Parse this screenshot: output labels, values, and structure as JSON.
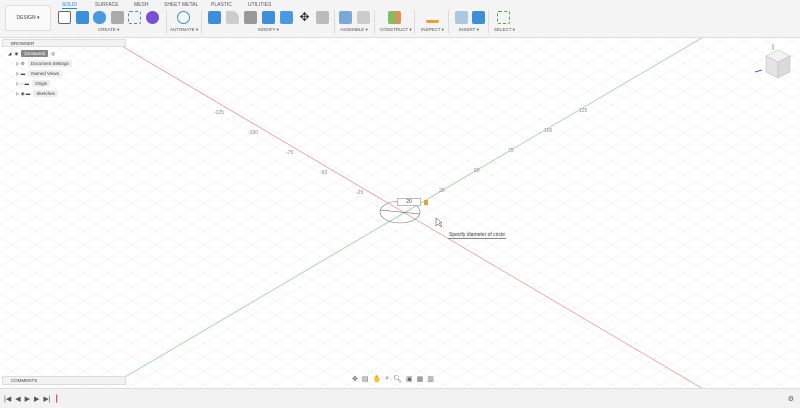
{
  "toolbar": {
    "workspace": "DESIGN ▾",
    "tabs": [
      "SOLID",
      "SURFACE",
      "MESH",
      "SHEET METAL",
      "PLASTIC",
      "UTILITIES"
    ],
    "groups": [
      "CREATE ▾",
      "AUTOMATE ▾",
      "MODIFY ▾",
      "ASSEMBLE ▾",
      "CONSTRUCT ▾",
      "INSPECT ▾",
      "INSERT ▾",
      "SELECT ▾"
    ]
  },
  "browser": {
    "title": "BROWSER",
    "root": "(Unsaved)",
    "items": [
      "Document Settings",
      "Named Views",
      "Origin",
      "Sketches"
    ]
  },
  "comments": {
    "title": "COMMENTS"
  },
  "canvas": {
    "dimension_value": "20",
    "tooltip": "Specify diameter of circle",
    "x_axis_labels": [
      "-125",
      "-100",
      "-75",
      "-50",
      "-25"
    ],
    "y_axis_labels": [
      "25",
      "50",
      "75",
      "100",
      "125"
    ],
    "colors": {
      "x_axis": "#e89a9a",
      "y_axis": "#9ad89a",
      "accent": "#1a8ad4"
    }
  },
  "timeline": {
    "controls": [
      "|◀",
      "◀",
      "▶",
      "▶",
      "▶|"
    ]
  }
}
